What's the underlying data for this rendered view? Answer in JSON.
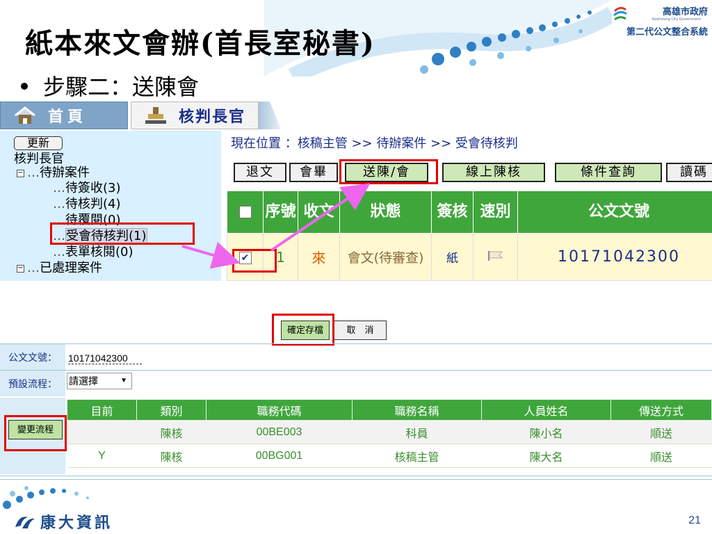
{
  "slide": {
    "title": "紙本來文會辦(首長室秘書)",
    "bullet": "步驟二：送陳會",
    "page_number": "21",
    "company": "康大資訊"
  },
  "logo": {
    "org": "高雄市政府",
    "sub": "Kaohsiung City Government",
    "system": "第二代公文整合系統"
  },
  "screen1": {
    "tabs": [
      {
        "label": "首頁",
        "icon": "house-icon"
      },
      {
        "label": "核判長官",
        "icon": "stamp-icon"
      }
    ],
    "sidebar": {
      "refresh": "更新",
      "role": "核判長官",
      "pending_group": "待辦案件",
      "pending_items": [
        "待簽收(3)",
        "待核判(4)",
        "待覆閱(0)",
        "受會待核判(1)",
        "表單核閱(0)"
      ],
      "done_group": "已處理案件"
    },
    "breadcrumb": "現在位置 ：核稿主管 >> 待辦案件 >> 受會待核判",
    "actions": [
      "退文",
      "會畢",
      "送陳/會",
      "線上陳核",
      "條件查詢",
      "讀碼"
    ],
    "table": {
      "headers": [
        "序號",
        "收文",
        "狀態",
        "簽核",
        "速別",
        "公文文號"
      ],
      "rows": [
        {
          "seq": "1",
          "recv": "來",
          "status": "會文(待審查)",
          "sign": "紙",
          "speed_icon": "flag-icon",
          "doc_no": "10171042300"
        }
      ]
    }
  },
  "screen2": {
    "save": "確定存檔",
    "cancel": "取　消",
    "doc_no_label": "公文文號：",
    "doc_no_value": "10171042300",
    "flow_label": "預設流程：",
    "flow_select": "請選擇",
    "change_flow": "變更流程",
    "headers": [
      "目前",
      "類別",
      "職務代碼",
      "職務名稱",
      "人員姓名",
      "傳送方式"
    ],
    "rows": [
      [
        "",
        "陳核",
        "00BE003",
        "科員",
        "陳小名",
        "順送"
      ],
      [
        "Y",
        "陳核",
        "00BG001",
        "核稿主管",
        "陳大名",
        "順送"
      ]
    ]
  },
  "colors": {
    "header_green": "#3fa63c",
    "highlight_red": "#e00000",
    "arrow_pink": "#ee66ee",
    "sidebar_blue": "#d8f0ff"
  }
}
